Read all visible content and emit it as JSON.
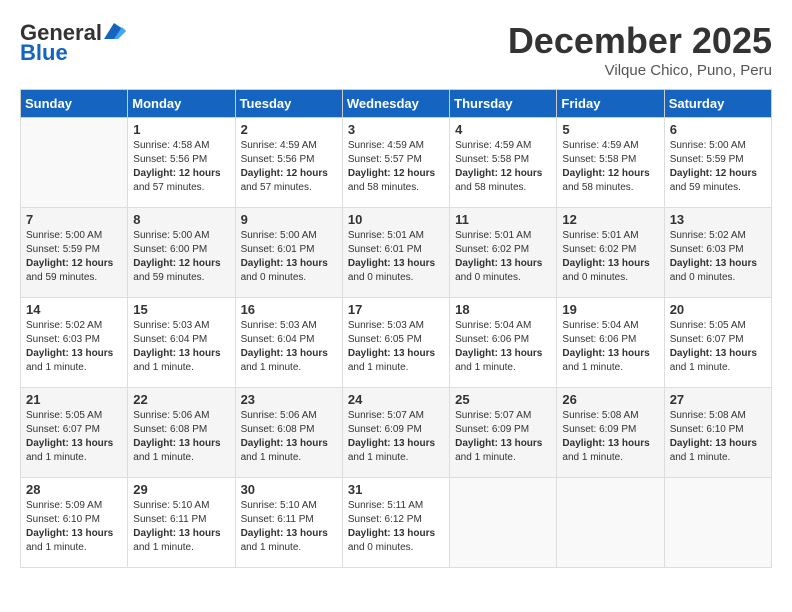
{
  "header": {
    "logo_general": "General",
    "logo_blue": "Blue",
    "month": "December 2025",
    "location": "Vilque Chico, Puno, Peru"
  },
  "weekdays": [
    "Sunday",
    "Monday",
    "Tuesday",
    "Wednesday",
    "Thursday",
    "Friday",
    "Saturday"
  ],
  "weeks": [
    [
      {
        "day": "",
        "info": ""
      },
      {
        "day": "1",
        "info": "Sunrise: 4:58 AM\nSunset: 5:56 PM\nDaylight: 12 hours\nand 57 minutes."
      },
      {
        "day": "2",
        "info": "Sunrise: 4:59 AM\nSunset: 5:56 PM\nDaylight: 12 hours\nand 57 minutes."
      },
      {
        "day": "3",
        "info": "Sunrise: 4:59 AM\nSunset: 5:57 PM\nDaylight: 12 hours\nand 58 minutes."
      },
      {
        "day": "4",
        "info": "Sunrise: 4:59 AM\nSunset: 5:58 PM\nDaylight: 12 hours\nand 58 minutes."
      },
      {
        "day": "5",
        "info": "Sunrise: 4:59 AM\nSunset: 5:58 PM\nDaylight: 12 hours\nand 58 minutes."
      },
      {
        "day": "6",
        "info": "Sunrise: 5:00 AM\nSunset: 5:59 PM\nDaylight: 12 hours\nand 59 minutes."
      }
    ],
    [
      {
        "day": "7",
        "info": "Sunrise: 5:00 AM\nSunset: 5:59 PM\nDaylight: 12 hours\nand 59 minutes."
      },
      {
        "day": "8",
        "info": "Sunrise: 5:00 AM\nSunset: 6:00 PM\nDaylight: 12 hours\nand 59 minutes."
      },
      {
        "day": "9",
        "info": "Sunrise: 5:00 AM\nSunset: 6:01 PM\nDaylight: 13 hours\nand 0 minutes."
      },
      {
        "day": "10",
        "info": "Sunrise: 5:01 AM\nSunset: 6:01 PM\nDaylight: 13 hours\nand 0 minutes."
      },
      {
        "day": "11",
        "info": "Sunrise: 5:01 AM\nSunset: 6:02 PM\nDaylight: 13 hours\nand 0 minutes."
      },
      {
        "day": "12",
        "info": "Sunrise: 5:01 AM\nSunset: 6:02 PM\nDaylight: 13 hours\nand 0 minutes."
      },
      {
        "day": "13",
        "info": "Sunrise: 5:02 AM\nSunset: 6:03 PM\nDaylight: 13 hours\nand 0 minutes."
      }
    ],
    [
      {
        "day": "14",
        "info": "Sunrise: 5:02 AM\nSunset: 6:03 PM\nDaylight: 13 hours\nand 1 minute."
      },
      {
        "day": "15",
        "info": "Sunrise: 5:03 AM\nSunset: 6:04 PM\nDaylight: 13 hours\nand 1 minute."
      },
      {
        "day": "16",
        "info": "Sunrise: 5:03 AM\nSunset: 6:04 PM\nDaylight: 13 hours\nand 1 minute."
      },
      {
        "day": "17",
        "info": "Sunrise: 5:03 AM\nSunset: 6:05 PM\nDaylight: 13 hours\nand 1 minute."
      },
      {
        "day": "18",
        "info": "Sunrise: 5:04 AM\nSunset: 6:06 PM\nDaylight: 13 hours\nand 1 minute."
      },
      {
        "day": "19",
        "info": "Sunrise: 5:04 AM\nSunset: 6:06 PM\nDaylight: 13 hours\nand 1 minute."
      },
      {
        "day": "20",
        "info": "Sunrise: 5:05 AM\nSunset: 6:07 PM\nDaylight: 13 hours\nand 1 minute."
      }
    ],
    [
      {
        "day": "21",
        "info": "Sunrise: 5:05 AM\nSunset: 6:07 PM\nDaylight: 13 hours\nand 1 minute."
      },
      {
        "day": "22",
        "info": "Sunrise: 5:06 AM\nSunset: 6:08 PM\nDaylight: 13 hours\nand 1 minute."
      },
      {
        "day": "23",
        "info": "Sunrise: 5:06 AM\nSunset: 6:08 PM\nDaylight: 13 hours\nand 1 minute."
      },
      {
        "day": "24",
        "info": "Sunrise: 5:07 AM\nSunset: 6:09 PM\nDaylight: 13 hours\nand 1 minute."
      },
      {
        "day": "25",
        "info": "Sunrise: 5:07 AM\nSunset: 6:09 PM\nDaylight: 13 hours\nand 1 minute."
      },
      {
        "day": "26",
        "info": "Sunrise: 5:08 AM\nSunset: 6:09 PM\nDaylight: 13 hours\nand 1 minute."
      },
      {
        "day": "27",
        "info": "Sunrise: 5:08 AM\nSunset: 6:10 PM\nDaylight: 13 hours\nand 1 minute."
      }
    ],
    [
      {
        "day": "28",
        "info": "Sunrise: 5:09 AM\nSunset: 6:10 PM\nDaylight: 13 hours\nand 1 minute."
      },
      {
        "day": "29",
        "info": "Sunrise: 5:10 AM\nSunset: 6:11 PM\nDaylight: 13 hours\nand 1 minute."
      },
      {
        "day": "30",
        "info": "Sunrise: 5:10 AM\nSunset: 6:11 PM\nDaylight: 13 hours\nand 1 minute."
      },
      {
        "day": "31",
        "info": "Sunrise: 5:11 AM\nSunset: 6:12 PM\nDaylight: 13 hours\nand 0 minutes."
      },
      {
        "day": "",
        "info": ""
      },
      {
        "day": "",
        "info": ""
      },
      {
        "day": "",
        "info": ""
      }
    ]
  ]
}
